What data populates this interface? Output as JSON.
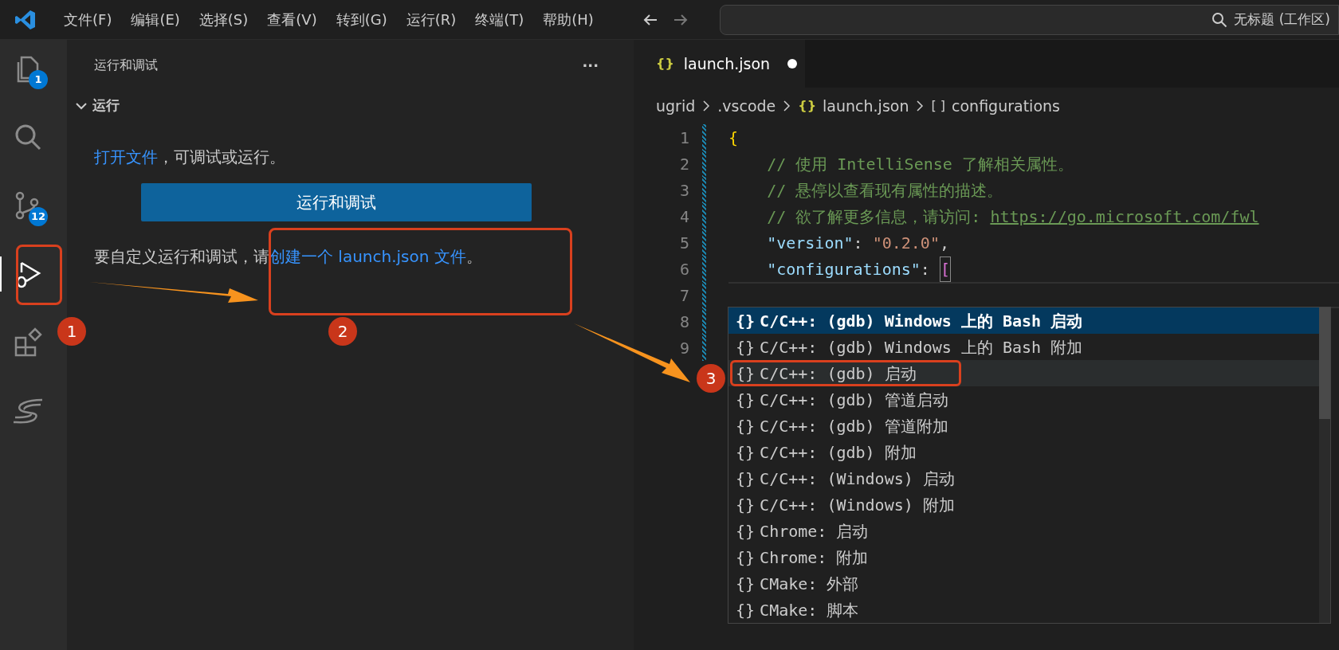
{
  "menu": [
    "文件(F)",
    "编辑(E)",
    "选择(S)",
    "查看(V)",
    "转到(G)",
    "运行(R)",
    "终端(T)",
    "帮助(H)"
  ],
  "search": {
    "value": "无标题 (工作区)"
  },
  "activity_bar": [
    {
      "kind": "files",
      "badge": "1",
      "selected": false
    },
    {
      "kind": "search",
      "selected": false
    },
    {
      "kind": "git",
      "badge": "12",
      "selected": false
    },
    {
      "kind": "run",
      "selected": true
    },
    {
      "kind": "extensions",
      "selected": false
    },
    {
      "kind": "s-logo",
      "selected": false
    }
  ],
  "sidebar": {
    "title": "运行和调试",
    "more": "···",
    "section": {
      "title": "运行",
      "expanded": true
    },
    "open_file": {
      "link": "打开文件",
      "text": "，可调试或运行。"
    },
    "button": "运行和调试",
    "customize": {
      "text": "要自定义运行和调试，请",
      "link": "创建一个 launch.json 文件",
      "end": "。"
    }
  },
  "tab": {
    "icon": "{}",
    "label": "launch.json",
    "modified": true
  },
  "breadcrumb": [
    {
      "label": "ugrid"
    },
    {
      "label": ".vscode"
    },
    {
      "icon": "{}",
      "label": "launch.json"
    },
    {
      "icon": "[ ]",
      "label": "configurations"
    }
  ],
  "code": [
    {
      "number": "1",
      "current": false,
      "tokens": [
        {
          "kind": "brace",
          "text": "{"
        }
      ]
    },
    {
      "number": "2",
      "current": false,
      "tokens": [
        {
          "kind": "comment",
          "text": "    // 使用 IntelliSense 了解相关属性。"
        }
      ]
    },
    {
      "number": "3",
      "current": false,
      "tokens": [
        {
          "kind": "comment",
          "text": "    // 悬停以查看现有属性的描述。"
        }
      ]
    },
    {
      "number": "4",
      "current": false,
      "tokens": [
        {
          "kind": "comment",
          "text": "    // 欲了解更多信息，请访问: "
        },
        {
          "kind": "link",
          "text": "https://go.microsoft.com/fwl"
        }
      ]
    },
    {
      "number": "5",
      "current": false,
      "tokens": [
        {
          "kind": "key",
          "text": "    \"version\""
        },
        {
          "kind": "plain",
          "text": ": "
        },
        {
          "kind": "string",
          "text": "\"0.2.0\""
        },
        {
          "kind": "plain",
          "text": ","
        }
      ]
    },
    {
      "number": "6",
      "current": false,
      "tokens": [
        {
          "kind": "key",
          "text": "    \"configurations\""
        },
        {
          "kind": "plain",
          "text": ": "
        },
        {
          "kind": "bracket",
          "text": "["
        }
      ]
    },
    {
      "number": "7",
      "current": true
    },
    {
      "number": "8",
      "current": false
    },
    {
      "number": "9",
      "current": false
    }
  ],
  "suggestions": [
    {
      "label": "C/C++: (gdb) Windows 上的 Bash 启动",
      "selected": true,
      "hovered": false
    },
    {
      "label": "C/C++: (gdb) Windows 上的 Bash 附加",
      "selected": false,
      "hovered": false
    },
    {
      "label": "C/C++: (gdb) 启动",
      "selected": false,
      "hovered": true,
      "framed": true
    },
    {
      "label": "C/C++: (gdb) 管道启动",
      "selected": false,
      "hovered": false
    },
    {
      "label": "C/C++: (gdb) 管道附加",
      "selected": false,
      "hovered": false
    },
    {
      "label": "C/C++: (gdb) 附加",
      "selected": false,
      "hovered": false
    },
    {
      "label": "C/C++: (Windows) 启动",
      "selected": false,
      "hovered": false
    },
    {
      "label": "C/C++: (Windows) 附加",
      "selected": false,
      "hovered": false
    },
    {
      "label": "Chrome: 启动",
      "selected": false,
      "hovered": false
    },
    {
      "label": "Chrome: 附加",
      "selected": false,
      "hovered": false
    },
    {
      "label": "CMake: 外部",
      "selected": false,
      "hovered": false
    },
    {
      "label": "CMake: 脚本",
      "selected": false,
      "hovered": false
    }
  ],
  "suggestion_icon": "{}",
  "annotations": [
    "1",
    "2",
    "3"
  ]
}
